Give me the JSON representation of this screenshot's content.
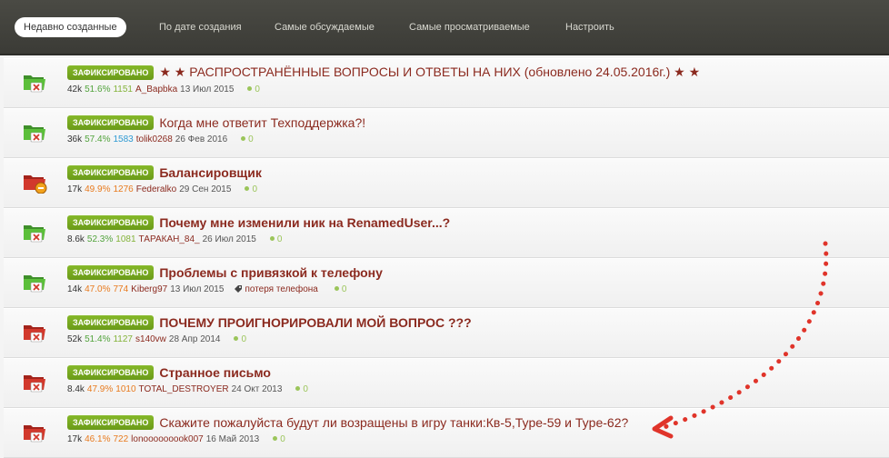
{
  "tabs": [
    {
      "label": "Недавно созданные",
      "active": true
    },
    {
      "label": "По дате создания",
      "active": false
    },
    {
      "label": "Самые обсуждаемые",
      "active": false
    },
    {
      "label": "Самые просматриваемые",
      "active": false
    },
    {
      "label": "Настроить",
      "active": false
    }
  ],
  "badge_label": "ЗАФИКСИРОВАНО",
  "topics": [
    {
      "icon": "folder-green-locked-icon",
      "title": "★ ★ РАСПРОСТРАНЁННЫЕ ВОПРОСЫ И ОТВЕТЫ НА НИХ (обновлено 24.05.2016г.) ★ ★",
      "bold": false,
      "views": "42k",
      "percent": "51.6%",
      "answers": "1151",
      "author": "A_Bapbka",
      "date": "13 Июл 2015",
      "score": "0",
      "tag": ""
    },
    {
      "icon": "folder-green-locked-icon",
      "title": "Когда мне ответит Техподдержка?!",
      "bold": false,
      "views": "36k",
      "percent": "57.4%",
      "answers": "1583",
      "author": "tolik0268",
      "date": "26 Фев 2016",
      "score": "0",
      "tag": ""
    },
    {
      "icon": "folder-red-warning-icon",
      "title": "Балансировщик",
      "bold": true,
      "views": "17k",
      "percent": "49.9%",
      "answers": "1276",
      "author": "Federalko",
      "date": "29 Сен 2015",
      "score": "0",
      "tag": ""
    },
    {
      "icon": "folder-green-locked-icon",
      "title": "Почему мне изменили ник на RenamedUser...?",
      "bold": true,
      "views": "8.6k",
      "percent": "52.3%",
      "answers": "1081",
      "author": "ТАРАКАН_84_",
      "date": "26 Июл 2015",
      "score": "0",
      "tag": ""
    },
    {
      "icon": "folder-green-locked-icon",
      "title": "Проблемы с привязкой к телефону",
      "bold": true,
      "views": "14k",
      "percent": "47.0%",
      "answers": "774",
      "author": "Kiberg97",
      "date": "13 Июл 2015",
      "score": "0",
      "tag": "потеря телефона"
    },
    {
      "icon": "folder-red-locked-icon",
      "title": "ПОЧЕМУ ПРОИГНОРИРОВАЛИ МОЙ ВОПРОС ???",
      "bold": true,
      "views": "52k",
      "percent": "51.4%",
      "answers": "1127",
      "author": "s140vw",
      "date": "28 Апр 2014",
      "score": "0",
      "tag": ""
    },
    {
      "icon": "folder-red-locked-icon",
      "title": "Странное письмо",
      "bold": true,
      "views": "8.4k",
      "percent": "47.9%",
      "answers": "1010",
      "author": "TOTAL_DESTROYER",
      "date": "24 Окт 2013",
      "score": "0",
      "tag": ""
    },
    {
      "icon": "folder-red-locked-icon",
      "title": "Скажите пожалуйста будут ли возращены в игру танки:Кв-5,Type-59 и Type-62?",
      "bold": false,
      "views": "17k",
      "percent": "46.1%",
      "answers": "722",
      "author": "lonooooooook007",
      "date": "16 Май 2013",
      "score": "0",
      "tag": ""
    }
  ],
  "colors": {
    "accent": "#8b2a1f",
    "badge": "#7aaa20",
    "arrow": "#e0342a"
  }
}
